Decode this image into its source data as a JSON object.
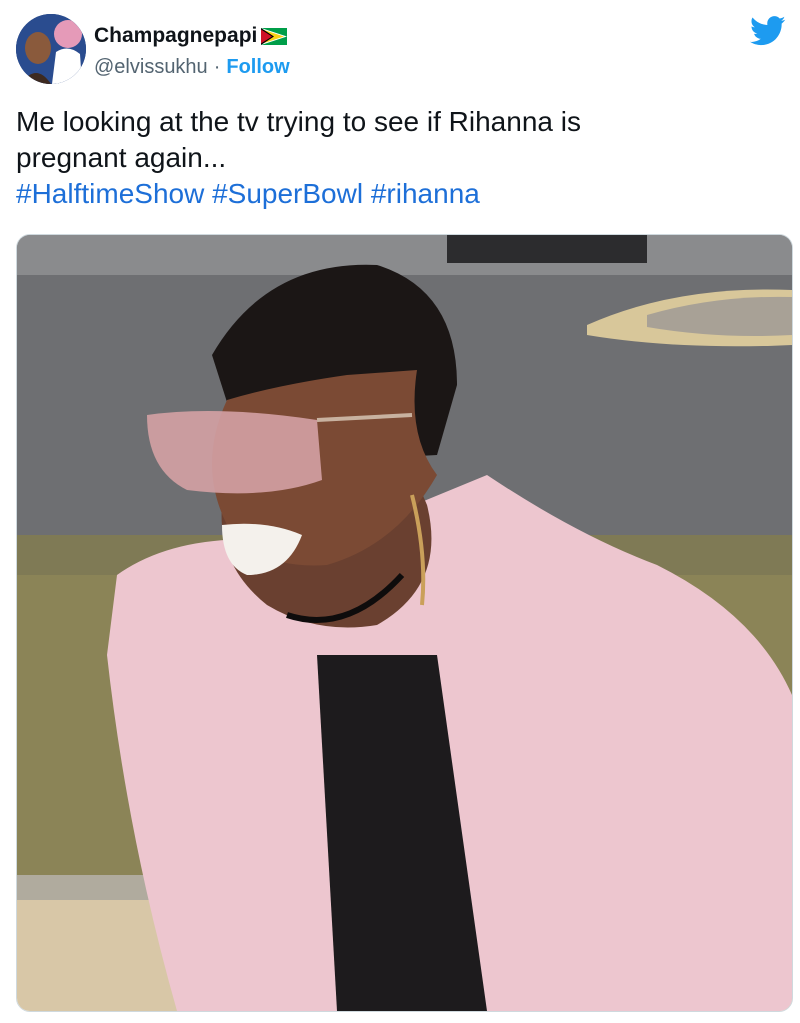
{
  "tweet": {
    "author": {
      "display_name": "Champagnepapi",
      "flag_icon": "guyana-flag-icon",
      "handle": "@elvissukhu",
      "separator": "·",
      "follow_label": "Follow"
    },
    "text_line1": "Me looking at the tv trying to see if Rihanna is",
    "text_line2": "pregnant again...",
    "hashtags": [
      "#HalftimeShow",
      "#SuperBowl",
      "#rihanna"
    ]
  },
  "icons": {
    "brand": "twitter-bird-icon"
  },
  "colors": {
    "accent": "#1d9bf0",
    "hashtag": "#1d6fd8",
    "text": "#0f1419",
    "muted": "#536471"
  }
}
